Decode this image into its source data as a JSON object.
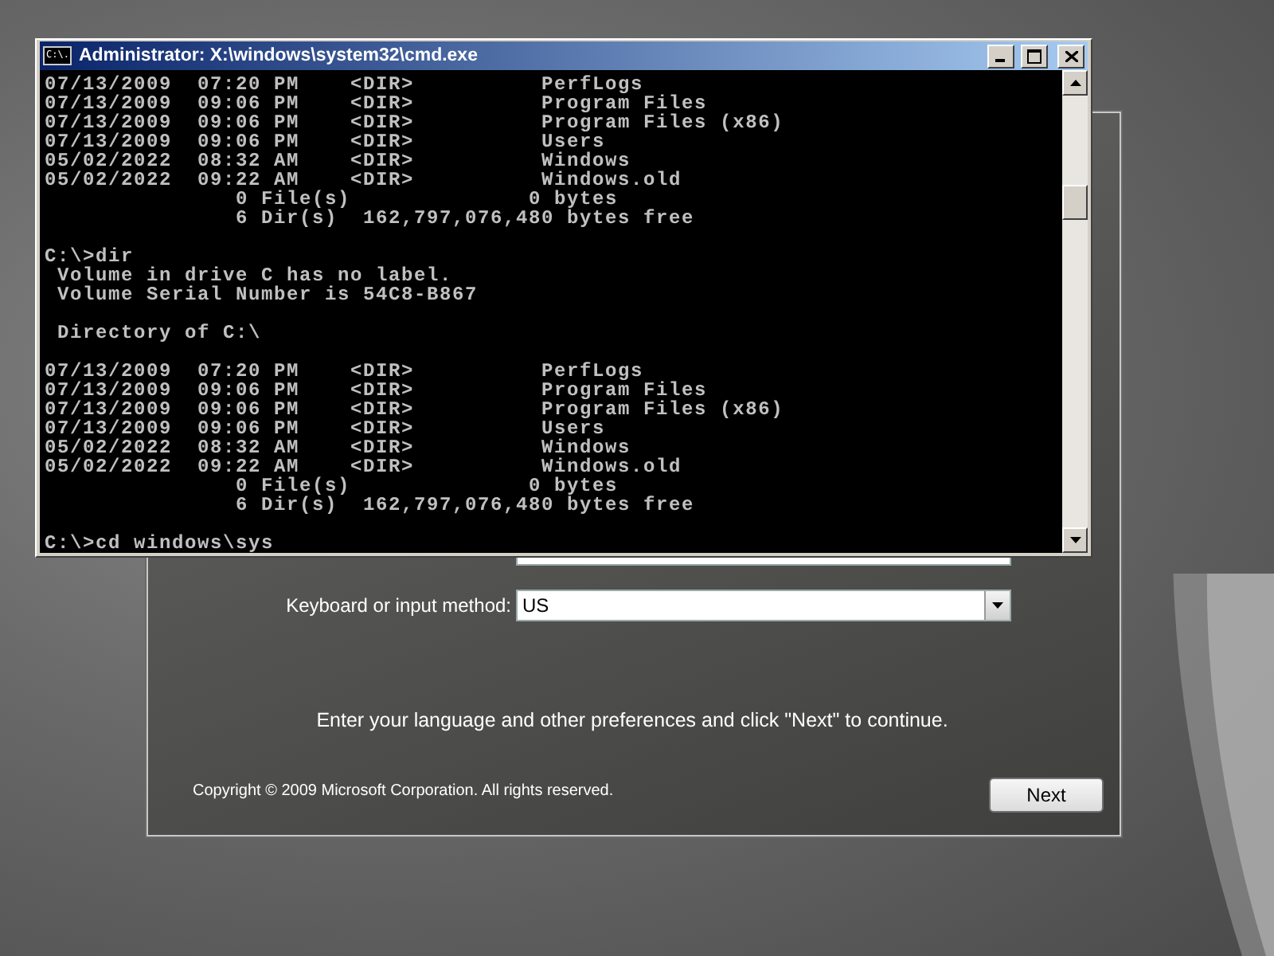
{
  "setup_dialog": {
    "keyboard": {
      "label": "Keyboard or input method:",
      "value": "US"
    },
    "instruction": "Enter your language and other preferences and click \"Next\" to continue.",
    "copyright": "Copyright © 2009 Microsoft Corporation. All rights reserved.",
    "next_button": "Next"
  },
  "console_window": {
    "title": "Administrator: X:\\windows\\system32\\cmd.exe",
    "icon_text": "C:\\.",
    "blocks": [
      [
        "07/13/2009  07:20 PM    <DIR>          PerfLogs",
        "07/13/2009  09:06 PM    <DIR>          Program Files",
        "07/13/2009  09:06 PM    <DIR>          Program Files (x86)",
        "07/13/2009  09:06 PM    <DIR>          Users",
        "05/02/2022  08:32 AM    <DIR>          Windows",
        "05/02/2022  09:22 AM    <DIR>          Windows.old",
        "               0 File(s)              0 bytes",
        "               6 Dir(s)  162,797,076,480 bytes free"
      ],
      [
        "C:\\>dir",
        " Volume in drive C has no label.",
        " Volume Serial Number is 54C8-B867"
      ],
      [
        " Directory of C:\\"
      ],
      [
        "07/13/2009  07:20 PM    <DIR>          PerfLogs",
        "07/13/2009  09:06 PM    <DIR>          Program Files",
        "07/13/2009  09:06 PM    <DIR>          Program Files (x86)",
        "07/13/2009  09:06 PM    <DIR>          Users",
        "05/02/2022  08:32 AM    <DIR>          Windows",
        "05/02/2022  09:22 AM    <DIR>          Windows.old",
        "               0 File(s)              0 bytes",
        "               6 Dir(s)  162,797,076,480 bytes free"
      ],
      [
        "C:\\>cd windows\\sys"
      ]
    ]
  }
}
